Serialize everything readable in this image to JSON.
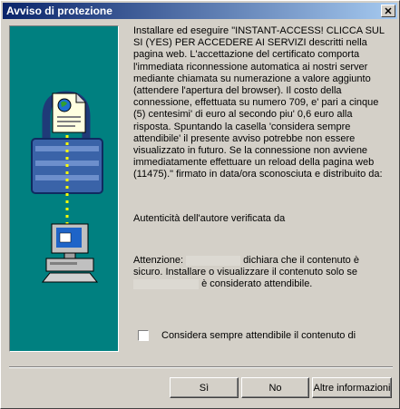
{
  "window": {
    "title": "Avviso di protezione",
    "close_glyph": "✕"
  },
  "illustration": {
    "icons": [
      "document-globe-icon",
      "padlock-icon",
      "computer-icon"
    ]
  },
  "message": "Installare ed eseguire \"INSTANT-ACCESS! CLICCA SUL SI (YES) PER ACCEDERE AI SERVIZI descritti nella pagina web. L'accettazione del certificato comporta l'immediata riconnessione automatica ai nostri server mediante chiamata su numerazione a valore aggiunto (attendere l'apertura del browser). Il costo della connessione, effettuata su  numero 709, e' pari a cinque (5) centesimi' di euro al secondo piu' 0,6 euro alla risposta. Spuntando la casella 'considera sempre attendibile' il presente avviso potrebbe non essere visualizzato in futuro. Se la connessione non avviene immediatamente effettuare un reload della pagina web (11475).\" firmato in data/ora sconosciuta e distribuito da:",
  "auth_line": "Autenticità dell'autore verificata da",
  "attention": {
    "prefix": "Attenzione:",
    "middle": "dichiara che il contenuto è sicuro. Installare o visualizzare il contenuto solo se",
    "suffix": "è considerato attendibile."
  },
  "checkbox": {
    "label": "Considera sempre attendibile il contenuto di",
    "checked": false
  },
  "buttons": {
    "yes": "Sì",
    "no": "No",
    "more": "Altre informazioni"
  }
}
